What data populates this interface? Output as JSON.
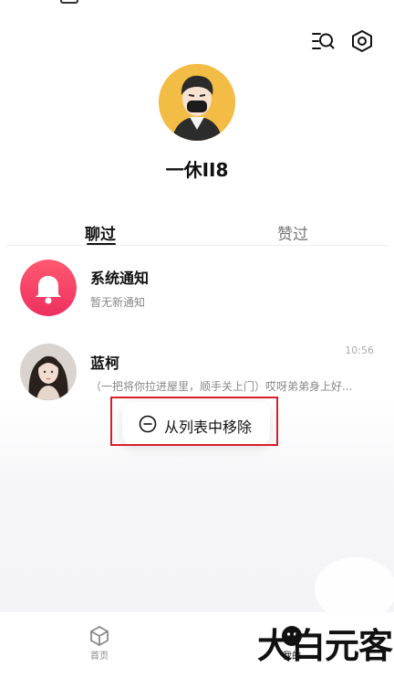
{
  "profile": {
    "username": "一休II8"
  },
  "tabs": [
    {
      "label": "聊过",
      "active": true
    },
    {
      "label": "赞过",
      "active": false
    }
  ],
  "chats": [
    {
      "title": "系统通知",
      "subtitle": "暂无新通知",
      "time": "",
      "avatar": "bell-icon"
    },
    {
      "title": "蓝柯",
      "subtitle": "（一把将你拉进屋里，顺手关上门）哎呀弟弟身上好...",
      "time": "10:56",
      "avatar": "user-photo"
    }
  ],
  "context_menu": {
    "remove_label": "从列表中移除",
    "icon": "minus-circle-icon"
  },
  "bottom_nav": [
    {
      "label": "首页",
      "icon": "cube-icon"
    },
    {
      "label": "我的",
      "icon": "face-icon"
    }
  ],
  "watermark": "大白元客",
  "colors": {
    "accent_bell": "#f23b66",
    "avatar_bg": "#f3bc44",
    "highlight": "#d81e2a"
  }
}
